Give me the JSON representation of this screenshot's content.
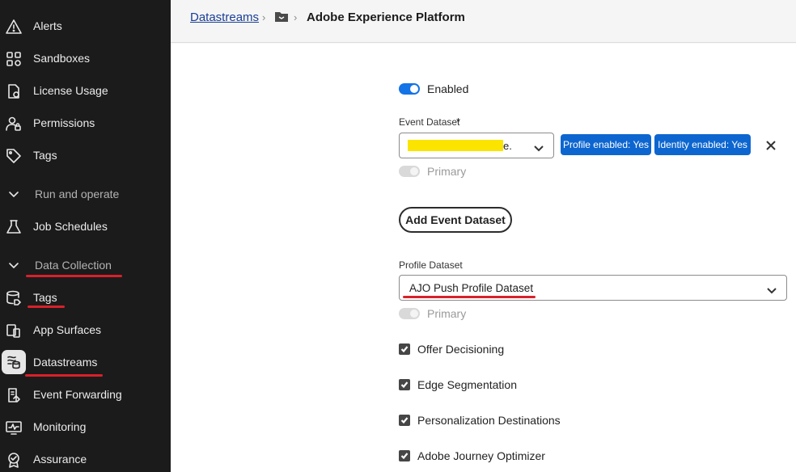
{
  "sidebar": {
    "items": [
      {
        "label": "Alerts",
        "icon": "alert-icon"
      },
      {
        "label": "Sandboxes",
        "icon": "sandboxes-icon"
      },
      {
        "label": "License Usage",
        "icon": "license-icon"
      },
      {
        "label": "Permissions",
        "icon": "permissions-icon"
      },
      {
        "label": "Tags",
        "icon": "tag-icon"
      },
      {
        "label": "Run and operate",
        "icon": "chevron-down-icon"
      },
      {
        "label": "Job Schedules",
        "icon": "flask-icon"
      },
      {
        "label": "Data Collection",
        "icon": "chevron-down-icon"
      },
      {
        "label": "Tags",
        "icon": "database-tag-icon"
      },
      {
        "label": "App Surfaces",
        "icon": "devices-icon"
      },
      {
        "label": "Datastreams",
        "icon": "datastreams-icon"
      },
      {
        "label": "Event Forwarding",
        "icon": "event-forwarding-icon"
      },
      {
        "label": "Monitoring",
        "icon": "monitoring-icon"
      },
      {
        "label": "Assurance",
        "icon": "assurance-icon"
      }
    ],
    "annotation_color": "#d8212a"
  },
  "header": {
    "breadcrumb_link": "Datastreams",
    "separator": "›",
    "folder_icon": "folder-icon",
    "title": "Adobe Experience Platform"
  },
  "main": {
    "enabled_label": "Enabled",
    "event_dataset_label": "Event Dataset",
    "required_mark": "*",
    "event_dataset_value_suffix": "e.",
    "profile_enabled_badge": "Profile enabled: Yes",
    "identity_enabled_badge": "Identity enabled: Yes",
    "primary_label": "Primary",
    "add_event_dataset_button": "Add Event Dataset",
    "profile_dataset_label": "Profile Dataset",
    "profile_dataset_value": "AJO Push Profile Dataset",
    "profile_primary_label": "Primary",
    "checkboxes": [
      {
        "label": "Offer Decisioning",
        "checked": true
      },
      {
        "label": "Edge Segmentation",
        "checked": true
      },
      {
        "label": "Personalization Destinations",
        "checked": true
      },
      {
        "label": "Adobe Journey Optimizer",
        "checked": true
      }
    ]
  },
  "colors": {
    "accent_blue": "#1473e6",
    "badge_blue": "#0d66d0",
    "redaction_yellow": "#fbe400",
    "annotation_red": "#d8212a"
  }
}
